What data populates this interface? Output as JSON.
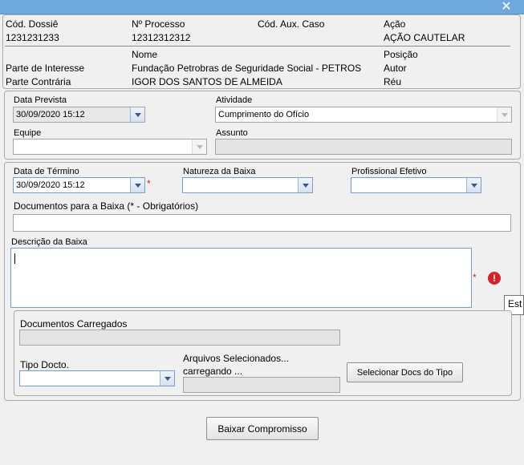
{
  "window": {
    "close_glyph": "✕"
  },
  "header": {
    "dossie_label": "Cód. Dossiê",
    "dossie_value": "1231231233",
    "processo_label": "Nº Processo",
    "processo_value": "12312312312",
    "aux_label": "Cód. Aux. Caso",
    "acao_label": "Ação",
    "acao_value": "AÇÃO CAUTELAR",
    "nome_header": "Nome",
    "posicao_header": "Posição",
    "parties": [
      {
        "role": "Parte de Interesse",
        "name": "Fundação Petrobras de Seguridade Social - PETROS",
        "position": "Autor"
      },
      {
        "role": "Parte Contrária",
        "name": "IGOR DOS SANTOS DE ALMEIDA",
        "position": "Réu"
      }
    ]
  },
  "task": {
    "data_prevista_label": "Data Prevista",
    "data_prevista_value": "30/09/2020 15:12",
    "atividade_label": "Atividade",
    "atividade_value": "Cumprimento do Ofício",
    "equipe_label": "Equipe",
    "equipe_value": "",
    "assunto_label": "Assunto",
    "assunto_value": ""
  },
  "baixa": {
    "data_termino_label": "Data de Término",
    "data_termino_value": "30/09/2020 15:12",
    "required_mark": "*",
    "natureza_label": "Natureza da Baixa",
    "natureza_value": "",
    "profissional_label": "Profissional Efetivo",
    "profissional_value": "",
    "documentos_label": "Documentos para a Baixa (* - Obrigatórios)",
    "documentos_value": "",
    "descricao_label": "Descrição da Baixa",
    "descricao_value": "",
    "error_glyph": "!",
    "tooltip_text": "Est"
  },
  "uploads": {
    "carregados_label": "Documentos Carregados",
    "carregados_value": "",
    "tipo_label": "Tipo Docto.",
    "tipo_value": "",
    "arquivos_label_line1": "Arquivos Selecionados...",
    "arquivos_label_line2": "carregando ...",
    "arquivos_value": "",
    "select_button": "Selecionar Docs do Tipo"
  },
  "footer": {
    "submit_button": "Baixar Compromisso"
  },
  "colors": {
    "titlebar": "#6fa8dc",
    "required": "#e02020",
    "error": "#d42027",
    "combo_border": "#7a9cc6"
  }
}
